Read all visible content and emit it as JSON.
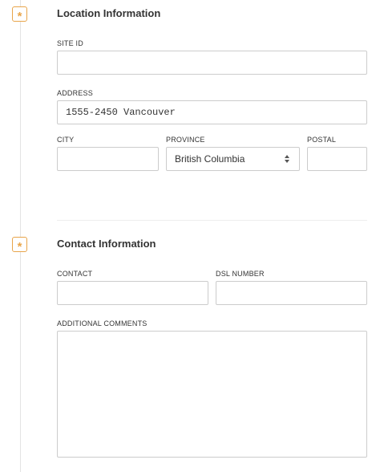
{
  "location": {
    "title": "Location Information",
    "site_id": {
      "label": "SITE ID",
      "value": ""
    },
    "address": {
      "label": "ADDRESS",
      "value": "1555-2450 Vancouver"
    },
    "city": {
      "label": "CITY",
      "value": ""
    },
    "province": {
      "label": "PROVINCE",
      "selected": "British Columbia"
    },
    "postal": {
      "label": "POSTAL",
      "value": ""
    }
  },
  "contact": {
    "title": "Contact Information",
    "contact": {
      "label": "CONTACT",
      "value": ""
    },
    "dsl_number": {
      "label": "DSL NUMBER",
      "value": ""
    },
    "comments": {
      "label": "ADDITIONAL COMMENTS",
      "value": ""
    }
  },
  "markers": {
    "glyph": "*",
    "color": "#e8a54a"
  },
  "icons": {
    "required": "asterisk-icon",
    "select_arrows": "updown-arrows-icon"
  }
}
